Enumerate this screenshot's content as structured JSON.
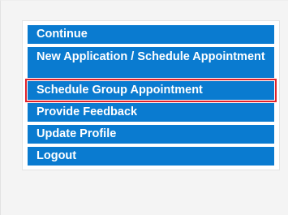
{
  "menu": {
    "items": [
      {
        "label": "Continue",
        "selected": false
      },
      {
        "label": "New Application / Schedule Appointment",
        "selected": false
      },
      {
        "label": "Schedule Group Appointment",
        "selected": true
      },
      {
        "label": "Provide Feedback",
        "selected": false
      },
      {
        "label": "Update Profile",
        "selected": false
      },
      {
        "label": "Logout",
        "selected": false
      }
    ]
  },
  "colors": {
    "menu_bg": "#0a7bd0",
    "menu_text": "#ffffff",
    "highlight_border": "#e1222a"
  }
}
